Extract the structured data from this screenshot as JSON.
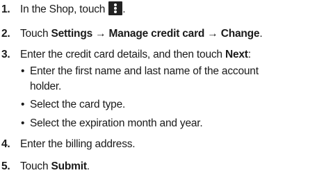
{
  "steps": [
    {
      "number": "1.",
      "text": "In the Shop, touch",
      "trail": ".",
      "icon": "more-options-icon"
    },
    {
      "number": "2.",
      "prefix": "Touch ",
      "bold_1": "Settings",
      "arrow_1": " → ",
      "bold_2": "Manage credit card",
      "arrow_2": " → ",
      "bold_3": "Change",
      "trail": "."
    },
    {
      "number": "3.",
      "text": "Enter the credit card details, and then touch ",
      "bold": "Next",
      "trail": ":",
      "bullets": [
        "Enter the first name and last name of the account holder.",
        "Select the card type.",
        "Select the expiration month and year."
      ]
    },
    {
      "number": "4.",
      "text": "Enter the billing address."
    },
    {
      "number": "5.",
      "prefix": "Touch ",
      "bold": "Submit",
      "trail": "."
    }
  ],
  "bullet_glyph": "•"
}
